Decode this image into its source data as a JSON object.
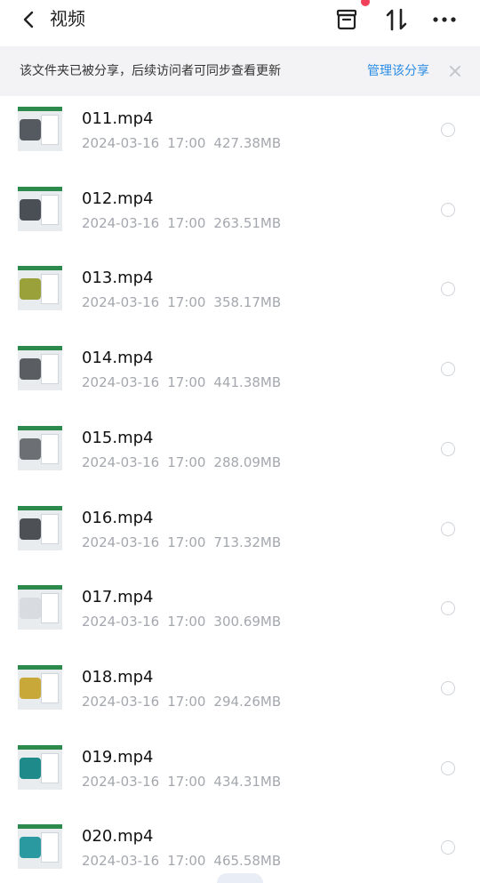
{
  "header": {
    "title": "视频",
    "icons": [
      "back-chevron-icon",
      "archive-box-icon",
      "sort-arrows-icon",
      "more-dots-icon"
    ],
    "notification_dot_color": "#f0405a"
  },
  "banner": {
    "text": "该文件夹已被分享，后续访问者可同步查看更新",
    "link": "管理该分享",
    "link_color": "#2a8ce6",
    "close_icon": "close-icon"
  },
  "files": [
    {
      "name": "011.mp4",
      "date": "2024-03-16",
      "time": "17:00",
      "size": "427.38MB",
      "thumb_accent": "#555a60"
    },
    {
      "name": "012.mp4",
      "date": "2024-03-16",
      "time": "17:00",
      "size": "263.51MB",
      "thumb_accent": "#4a4f55"
    },
    {
      "name": "013.mp4",
      "date": "2024-03-16",
      "time": "17:00",
      "size": "358.17MB",
      "thumb_accent": "#9aa03a"
    },
    {
      "name": "014.mp4",
      "date": "2024-03-16",
      "time": "17:00",
      "size": "441.38MB",
      "thumb_accent": "#5a5e63"
    },
    {
      "name": "015.mp4",
      "date": "2024-03-16",
      "time": "17:00",
      "size": "288.09MB",
      "thumb_accent": "#6c6f74"
    },
    {
      "name": "016.mp4",
      "date": "2024-03-16",
      "time": "17:00",
      "size": "713.32MB",
      "thumb_accent": "#4d5156"
    },
    {
      "name": "017.mp4",
      "date": "2024-03-16",
      "time": "17:00",
      "size": "300.69MB",
      "thumb_accent": "#d8dce0"
    },
    {
      "name": "018.mp4",
      "date": "2024-03-16",
      "time": "17:00",
      "size": "294.26MB",
      "thumb_accent": "#c9a83a"
    },
    {
      "name": "019.mp4",
      "date": "2024-03-16",
      "time": "17:00",
      "size": "434.31MB",
      "thumb_accent": "#1e8a8a"
    },
    {
      "name": "020.mp4",
      "date": "2024-03-16",
      "time": "17:00",
      "size": "465.58MB",
      "thumb_accent": "#2a9aa0"
    }
  ]
}
